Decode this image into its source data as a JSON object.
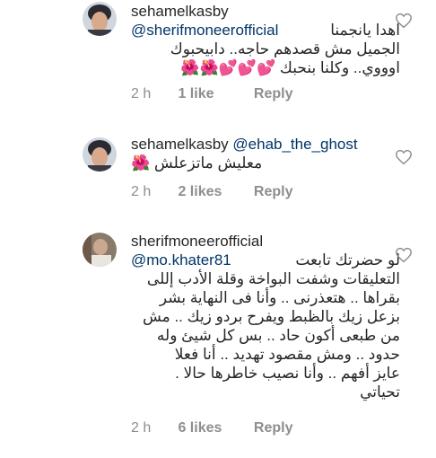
{
  "comments": [
    {
      "username": "sehamelkasby",
      "mention": "@sherifmoneerofficial",
      "lines": [
        "اهدا يانجمنا",
        "الجميل مش قصدهم حاجه.. دابيحبوك",
        "اوووي.. وكلنا بنحبك"
      ],
      "emoji_line3": "💕💕💕🌺🌺",
      "time": "2 h",
      "likes": "1 like",
      "reply": "Reply"
    },
    {
      "username": "sehamelkasby",
      "mention": "@ehab_the_ghost",
      "lines": [
        "معليش ماتزعلش"
      ],
      "emoji_line1": "🌺",
      "time": "2 h",
      "likes": "2 likes",
      "reply": "Reply"
    },
    {
      "username": "sherifmoneerofficial",
      "prefix": "لو حضرتك تابعت",
      "mention": "@mo.khater81",
      "lines": [
        "التعليقات وشفت البواخة وقلة الأدب إللى",
        "بقراها .. هتعذرنى .. وأنا فى النهاية بشر",
        "بزعل زيك بالظبط ويفرح بردو زيك .. مش",
        "من طبعى أكون حاد .. بس كل شيئ وله",
        "حدود .. ومش مقصود تهديد .. أنا فعلا",
        "عايز أفهم .. وأنا نصيب خاطرها حالا .",
        "تحياتي"
      ],
      "time": "2 h",
      "likes": "6 likes",
      "reply": "Reply"
    }
  ]
}
